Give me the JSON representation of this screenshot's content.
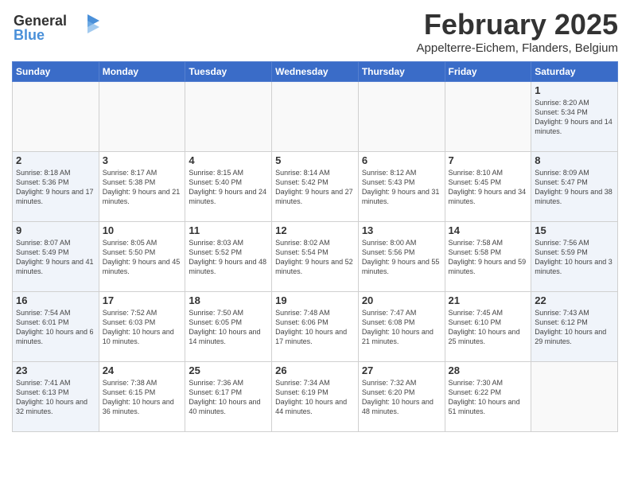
{
  "logo": {
    "line1": "General",
    "line2": "Blue"
  },
  "title": "February 2025",
  "subtitle": "Appelterre-Eichem, Flanders, Belgium",
  "days_of_week": [
    "Sunday",
    "Monday",
    "Tuesday",
    "Wednesday",
    "Thursday",
    "Friday",
    "Saturday"
  ],
  "weeks": [
    [
      {
        "day": "",
        "info": "",
        "type": "empty"
      },
      {
        "day": "",
        "info": "",
        "type": "empty"
      },
      {
        "day": "",
        "info": "",
        "type": "empty"
      },
      {
        "day": "",
        "info": "",
        "type": "empty"
      },
      {
        "day": "",
        "info": "",
        "type": "empty"
      },
      {
        "day": "",
        "info": "",
        "type": "empty"
      },
      {
        "day": "1",
        "info": "Sunrise: 8:20 AM\nSunset: 5:34 PM\nDaylight: 9 hours\nand 14 minutes.",
        "type": "weekend"
      }
    ],
    [
      {
        "day": "2",
        "info": "Sunrise: 8:18 AM\nSunset: 5:36 PM\nDaylight: 9 hours\nand 17 minutes.",
        "type": "weekend"
      },
      {
        "day": "3",
        "info": "Sunrise: 8:17 AM\nSunset: 5:38 PM\nDaylight: 9 hours\nand 21 minutes.",
        "type": "normal"
      },
      {
        "day": "4",
        "info": "Sunrise: 8:15 AM\nSunset: 5:40 PM\nDaylight: 9 hours\nand 24 minutes.",
        "type": "normal"
      },
      {
        "day": "5",
        "info": "Sunrise: 8:14 AM\nSunset: 5:42 PM\nDaylight: 9 hours\nand 27 minutes.",
        "type": "normal"
      },
      {
        "day": "6",
        "info": "Sunrise: 8:12 AM\nSunset: 5:43 PM\nDaylight: 9 hours\nand 31 minutes.",
        "type": "normal"
      },
      {
        "day": "7",
        "info": "Sunrise: 8:10 AM\nSunset: 5:45 PM\nDaylight: 9 hours\nand 34 minutes.",
        "type": "normal"
      },
      {
        "day": "8",
        "info": "Sunrise: 8:09 AM\nSunset: 5:47 PM\nDaylight: 9 hours\nand 38 minutes.",
        "type": "weekend"
      }
    ],
    [
      {
        "day": "9",
        "info": "Sunrise: 8:07 AM\nSunset: 5:49 PM\nDaylight: 9 hours\nand 41 minutes.",
        "type": "weekend"
      },
      {
        "day": "10",
        "info": "Sunrise: 8:05 AM\nSunset: 5:50 PM\nDaylight: 9 hours\nand 45 minutes.",
        "type": "normal"
      },
      {
        "day": "11",
        "info": "Sunrise: 8:03 AM\nSunset: 5:52 PM\nDaylight: 9 hours\nand 48 minutes.",
        "type": "normal"
      },
      {
        "day": "12",
        "info": "Sunrise: 8:02 AM\nSunset: 5:54 PM\nDaylight: 9 hours\nand 52 minutes.",
        "type": "normal"
      },
      {
        "day": "13",
        "info": "Sunrise: 8:00 AM\nSunset: 5:56 PM\nDaylight: 9 hours\nand 55 minutes.",
        "type": "normal"
      },
      {
        "day": "14",
        "info": "Sunrise: 7:58 AM\nSunset: 5:58 PM\nDaylight: 9 hours\nand 59 minutes.",
        "type": "normal"
      },
      {
        "day": "15",
        "info": "Sunrise: 7:56 AM\nSunset: 5:59 PM\nDaylight: 10 hours\nand 3 minutes.",
        "type": "weekend"
      }
    ],
    [
      {
        "day": "16",
        "info": "Sunrise: 7:54 AM\nSunset: 6:01 PM\nDaylight: 10 hours\nand 6 minutes.",
        "type": "weekend"
      },
      {
        "day": "17",
        "info": "Sunrise: 7:52 AM\nSunset: 6:03 PM\nDaylight: 10 hours\nand 10 minutes.",
        "type": "normal"
      },
      {
        "day": "18",
        "info": "Sunrise: 7:50 AM\nSunset: 6:05 PM\nDaylight: 10 hours\nand 14 minutes.",
        "type": "normal"
      },
      {
        "day": "19",
        "info": "Sunrise: 7:48 AM\nSunset: 6:06 PM\nDaylight: 10 hours\nand 17 minutes.",
        "type": "normal"
      },
      {
        "day": "20",
        "info": "Sunrise: 7:47 AM\nSunset: 6:08 PM\nDaylight: 10 hours\nand 21 minutes.",
        "type": "normal"
      },
      {
        "day": "21",
        "info": "Sunrise: 7:45 AM\nSunset: 6:10 PM\nDaylight: 10 hours\nand 25 minutes.",
        "type": "normal"
      },
      {
        "day": "22",
        "info": "Sunrise: 7:43 AM\nSunset: 6:12 PM\nDaylight: 10 hours\nand 29 minutes.",
        "type": "weekend"
      }
    ],
    [
      {
        "day": "23",
        "info": "Sunrise: 7:41 AM\nSunset: 6:13 PM\nDaylight: 10 hours\nand 32 minutes.",
        "type": "weekend"
      },
      {
        "day": "24",
        "info": "Sunrise: 7:38 AM\nSunset: 6:15 PM\nDaylight: 10 hours\nand 36 minutes.",
        "type": "normal"
      },
      {
        "day": "25",
        "info": "Sunrise: 7:36 AM\nSunset: 6:17 PM\nDaylight: 10 hours\nand 40 minutes.",
        "type": "normal"
      },
      {
        "day": "26",
        "info": "Sunrise: 7:34 AM\nSunset: 6:19 PM\nDaylight: 10 hours\nand 44 minutes.",
        "type": "normal"
      },
      {
        "day": "27",
        "info": "Sunrise: 7:32 AM\nSunset: 6:20 PM\nDaylight: 10 hours\nand 48 minutes.",
        "type": "normal"
      },
      {
        "day": "28",
        "info": "Sunrise: 7:30 AM\nSunset: 6:22 PM\nDaylight: 10 hours\nand 51 minutes.",
        "type": "normal"
      },
      {
        "day": "",
        "info": "",
        "type": "empty"
      }
    ]
  ]
}
